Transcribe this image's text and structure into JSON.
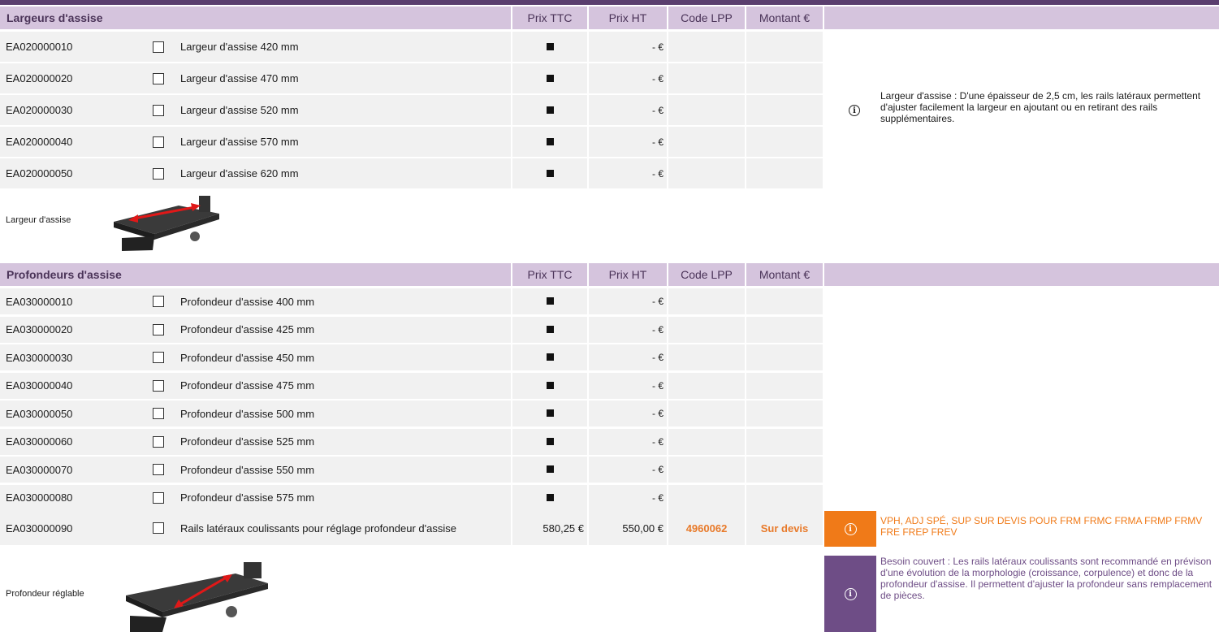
{
  "section1": {
    "title": "Largeurs d'assise",
    "columns": [
      "Prix TTC",
      "Prix HT",
      "Code LPP",
      "Montant €"
    ],
    "rows": [
      {
        "code": "EA020000010",
        "label": "Largeur d'assise 420 mm",
        "ht": "-  €"
      },
      {
        "code": "EA020000020",
        "label": "Largeur d'assise 470 mm",
        "ht": "-  €"
      },
      {
        "code": "EA020000030",
        "label": "Largeur d'assise 520 mm",
        "ht": "-  €"
      },
      {
        "code": "EA020000040",
        "label": "Largeur d'assise 570 mm",
        "ht": "-  €"
      },
      {
        "code": "EA020000050",
        "label": "Largeur d'assise 620 mm",
        "ht": "-  €"
      }
    ],
    "note": "Largeur d'assise : D'une épaisseur de 2,5 cm, les rails latéraux permettent d'ajuster facilement la largeur en ajoutant ou en retirant des rails supplémentaires.",
    "caption": "Largeur d'assise"
  },
  "section2": {
    "title": "Profondeurs d'assise",
    "columns": [
      "Prix TTC",
      "Prix HT",
      "Code LPP",
      "Montant €"
    ],
    "rows": [
      {
        "code": "EA030000010",
        "label": "Profondeur d'assise 400 mm",
        "ht": "-  €"
      },
      {
        "code": "EA030000020",
        "label": "Profondeur d'assise 425 mm",
        "ht": "-  €"
      },
      {
        "code": "EA030000030",
        "label": "Profondeur d'assise 450 mm",
        "ht": "-  €"
      },
      {
        "code": "EA030000040",
        "label": "Profondeur d'assise 475 mm",
        "ht": "-  €"
      },
      {
        "code": "EA030000050",
        "label": "Profondeur d'assise 500 mm",
        "ht": "-  €"
      },
      {
        "code": "EA030000060",
        "label": "Profondeur d'assise 525 mm",
        "ht": "-  €"
      },
      {
        "code": "EA030000070",
        "label": "Profondeur d'assise 550 mm",
        "ht": "-  €"
      },
      {
        "code": "EA030000080",
        "label": "Profondeur d'assise 575 mm",
        "ht": "-  €"
      }
    ],
    "special_row": {
      "code": "EA030000090",
      "label": "Rails latéraux coulissants pour réglage profondeur d'assise",
      "ttc": "580,25 €",
      "ht": "550,00 €",
      "lpp": "4960062",
      "montant": "Sur devis"
    },
    "orange_note": "VPH, ADJ SPÉ, SUP SUR DEVIS POUR FRM FRMC FRMA FRMP FRMV FRE FREP FREV",
    "purple_note": "Besoin couvert : Les rails latéraux coulissants sont recommandé en prévison d'une évolution de la morphologie (croissance, corpulence) et donc de la profondeur d'assise. Il permettent d'ajuster la profondeur sans remplacement de pièces.",
    "caption": "Profondeur réglable"
  },
  "icons": {
    "info": "info-icon",
    "checkbox": "checkbox",
    "price-marker": "filled-square"
  },
  "colors": {
    "header": "#d5c4dd",
    "topbar": "#5a3e6e",
    "orange": "#f07a18",
    "purple": "#6e4d86",
    "row": "#f1f1f1",
    "accent_text": "#e87a2a"
  }
}
